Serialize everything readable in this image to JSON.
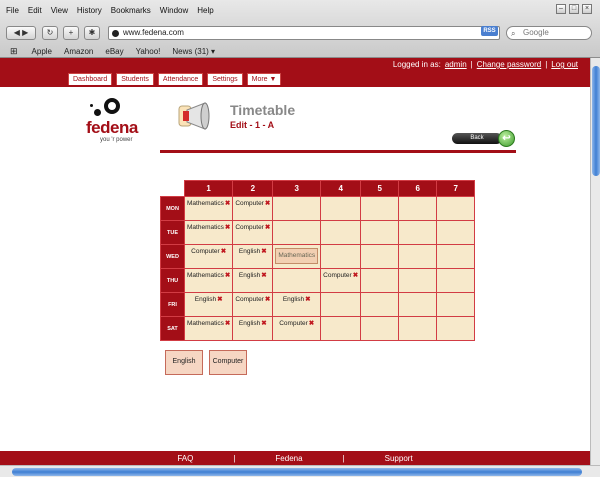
{
  "browser": {
    "menu": [
      "File",
      "Edit",
      "View",
      "History",
      "Bookmarks",
      "Window",
      "Help"
    ],
    "url": "www.fedena.com",
    "rss": "RSS",
    "search_placeholder": "Google",
    "bookmarks": [
      "Apple",
      "Amazon",
      "eBay",
      "Yahoo!",
      "News (31) ▾"
    ]
  },
  "app": {
    "logged_in_prefix": "Logged in as:",
    "user": "admin",
    "change_password": "Change password",
    "logout": "Log out",
    "tabs": [
      "Dashboard",
      "Students",
      "Attendance",
      "Settings",
      "More ▼"
    ],
    "logo_word": "fedena",
    "logo_tag": "you 'r power",
    "page_title": "Timetable",
    "page_subtitle": "Edit - 1 - A",
    "back_label": "Back",
    "footer": [
      "FAQ",
      "|",
      "Fedena",
      "|",
      "Support"
    ]
  },
  "timetable": {
    "periods": [
      "1",
      "2",
      "3",
      "4",
      "5",
      "6",
      "7"
    ],
    "days": [
      "MON",
      "TUE",
      "WED",
      "THU",
      "FRI",
      "SAT"
    ],
    "cells": [
      [
        "Mathematics",
        "Computer",
        "",
        "",
        "",
        "",
        ""
      ],
      [
        "Mathematics",
        "Computer",
        "",
        "",
        "",
        "",
        ""
      ],
      [
        "Computer",
        "English",
        "[Mathematics]",
        "",
        "",
        "",
        ""
      ],
      [
        "Mathematics",
        "English",
        "",
        "Computer",
        "",
        "",
        ""
      ],
      [
        "English",
        "Computer",
        "English",
        "",
        "",
        "",
        ""
      ],
      [
        "Mathematics",
        "English",
        "Computer",
        "",
        "",
        "",
        ""
      ]
    ],
    "subjects": [
      "English",
      "Computer"
    ]
  }
}
